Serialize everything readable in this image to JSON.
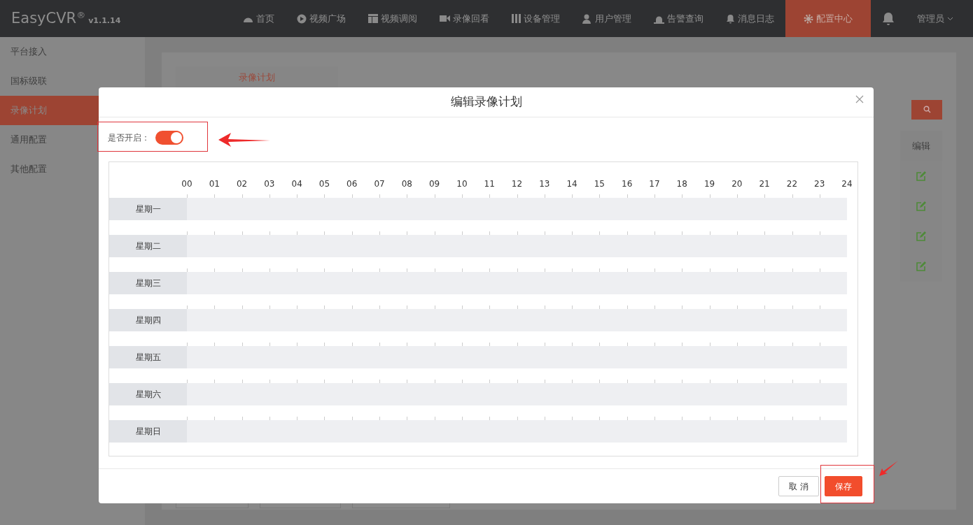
{
  "nav": {
    "brand": "EasyCVR$^{®}$",
    "version": "v1.1.14",
    "items": [
      {
        "label": "首页",
        "selected": false
      },
      {
        "label": "视频广场",
        "selected": false
      },
      {
        "label": "视频调阅",
        "selected": false
      },
      {
        "label": "录像回看",
        "selected": false
      },
      {
        "label": "设备管理",
        "selected": false
      },
      {
        "label": "用户管理",
        "selected": false
      },
      {
        "label": "告警查询",
        "selected": false
      },
      {
        "label": "消息日志",
        "selected": false
      },
      {
        "label": "配置中心",
        "selected": true
      }
    ],
    "user": "管理员"
  },
  "sidebar": {
    "items": [
      {
        "label": "平台接入",
        "selected": false
      },
      {
        "label": "国标级联",
        "selected": false
      },
      {
        "label": "录像计划",
        "selected": true
      },
      {
        "label": "通用配置",
        "selected": false
      },
      {
        "label": "其他配置",
        "selected": false
      }
    ]
  },
  "content": {
    "tab": "录像计划",
    "columns": [
      "编辑"
    ],
    "rows": [
      {
        "kind": "edit"
      },
      {
        "kind": "edit"
      },
      {
        "kind": "edit"
      },
      {
        "kind": "edit"
      }
    ]
  },
  "modal": {
    "title": "编辑录像计划",
    "enable_label": "是否开启：",
    "enabled": true,
    "hours": [
      "00",
      "01",
      "02",
      "03",
      "04",
      "05",
      "06",
      "07",
      "08",
      "09",
      "10",
      "11",
      "12",
      "13",
      "14",
      "15",
      "16",
      "17",
      "18",
      "19",
      "20",
      "21",
      "22",
      "23",
      "24"
    ],
    "days": [
      {
        "label": "星期一"
      },
      {
        "label": "星期二"
      },
      {
        "label": "星期三"
      },
      {
        "label": "星期四"
      },
      {
        "label": "星期五"
      },
      {
        "label": "星期六"
      },
      {
        "label": "星期日"
      }
    ],
    "buttons": [
      {
        "label": "取 消",
        "kind": "default"
      },
      {
        "label": "保存",
        "kind": "primary"
      }
    ]
  }
}
